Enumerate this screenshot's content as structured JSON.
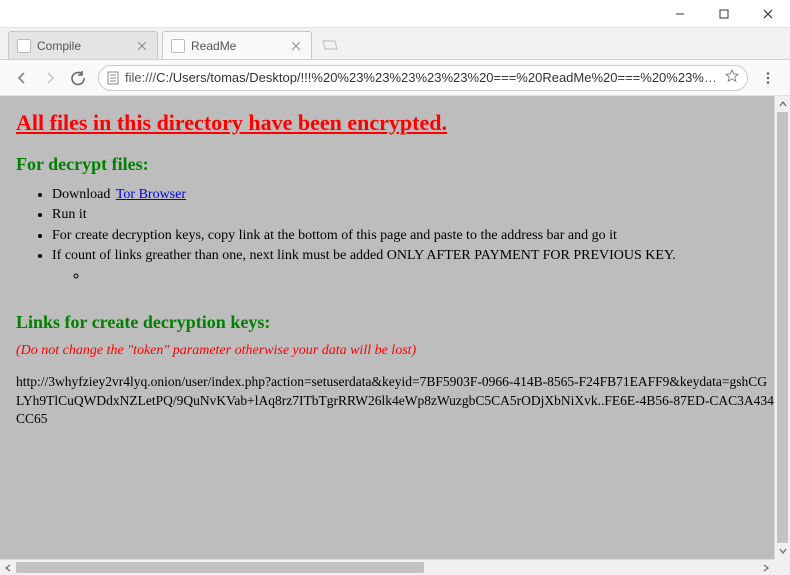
{
  "window": {
    "tabs": [
      {
        "label": "Compile",
        "active": false
      },
      {
        "label": "ReadMe",
        "active": true
      }
    ],
    "url_prefix": "file:///",
    "url_rest": "C:/Users/tomas/Desktop/!!!%20%23%23%23%23%23%20===%20ReadMe%20===%20%23%23%23%23%23..."
  },
  "page": {
    "h1": "All files in this directory have been encrypted.",
    "h2_decrypt": "For decrypt files:",
    "steps": {
      "download_prefix": "Download",
      "tor_link": "Tor Browser",
      "run": "Run it",
      "copy": "For create decryption keys, copy link at the bottom of this page and paste to the address bar and go it",
      "count": "If count of links greather than one, next link must be added ONLY AFTER PAYMENT FOR PREVIOUS KEY."
    },
    "h2_links": "Links for create decryption keys:",
    "warn": "(Do not change the \"token\" parameter otherwise your data will be lost)",
    "url_block": "http://3whyfziey2vr4lyq.onion/user/index.php?action=setuserdata&keyid=7BF5903F-0966-414B-8565-F24FB71EAFF9&keydata=gshCGLYh9TlCuQWDdxNZLetPQ/9QuNvKVab+lAq8rz7ITbTgrRRW26lk4eWp8zWuzgbC5CA5rODjXbNiXvk..FE6E-4B56-87ED-CAC3A434CC65"
  }
}
